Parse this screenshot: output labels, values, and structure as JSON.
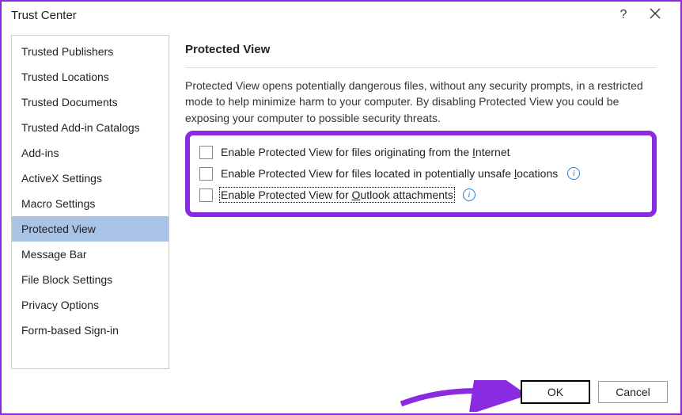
{
  "titlebar": {
    "title": "Trust Center",
    "help": "?",
    "close": "×"
  },
  "sidebar": {
    "items": [
      {
        "label": "Trusted Publishers",
        "selected": false
      },
      {
        "label": "Trusted Locations",
        "selected": false
      },
      {
        "label": "Trusted Documents",
        "selected": false
      },
      {
        "label": "Trusted Add-in Catalogs",
        "selected": false
      },
      {
        "label": "Add-ins",
        "selected": false
      },
      {
        "label": "ActiveX Settings",
        "selected": false
      },
      {
        "label": "Macro Settings",
        "selected": false
      },
      {
        "label": "Protected View",
        "selected": true
      },
      {
        "label": "Message Bar",
        "selected": false
      },
      {
        "label": "File Block Settings",
        "selected": false
      },
      {
        "label": "Privacy Options",
        "selected": false
      },
      {
        "label": "Form-based Sign-in",
        "selected": false
      }
    ]
  },
  "content": {
    "section_title": "Protected View",
    "description": "Protected View opens potentially dangerous files, without any security prompts, in a restricted mode to help minimize harm to your computer. By disabling Protected View you could be exposing your computer to possible security threats.",
    "options": [
      {
        "label_pre": "Enable Protected View for files originating from the ",
        "underline": "I",
        "label_post": "nternet",
        "info": false,
        "focused": false
      },
      {
        "label_pre": "Enable Protected View for files located in potentially unsafe ",
        "underline": "l",
        "label_post": "ocations",
        "info": true,
        "focused": false
      },
      {
        "label_pre": "Enable Protected View for ",
        "underline": "O",
        "label_post": "utlook attachments",
        "info": true,
        "focused": true
      }
    ]
  },
  "footer": {
    "ok": "OK",
    "cancel": "Cancel"
  },
  "colors": {
    "annotation": "#8a2be2",
    "selection": "#a9c3e6",
    "info": "#2b7cd3"
  }
}
